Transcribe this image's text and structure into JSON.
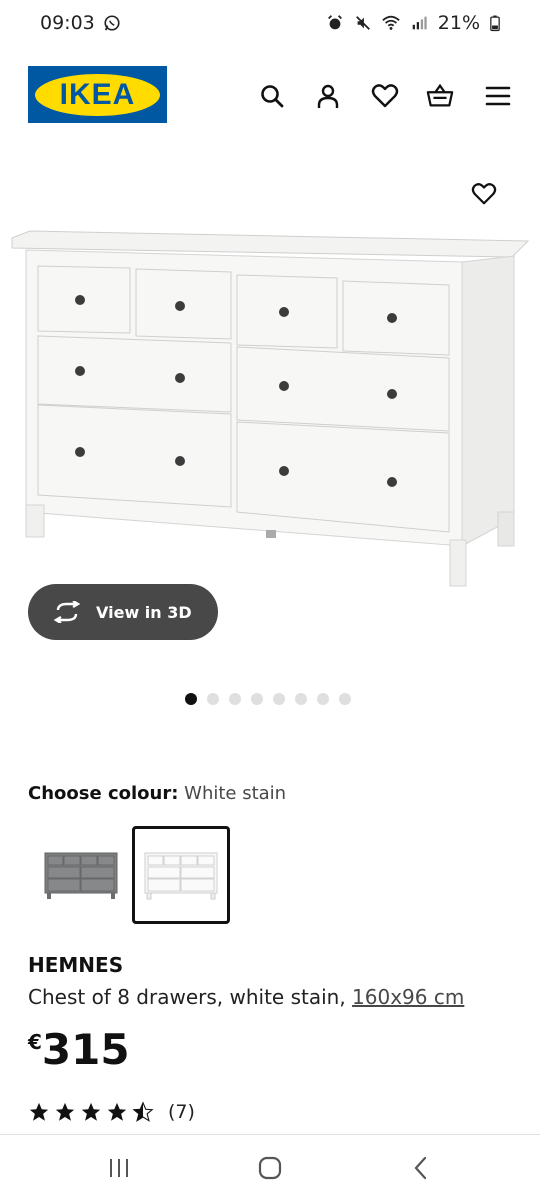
{
  "status": {
    "time": "09:03",
    "battery": "21%"
  },
  "header": {
    "logo_text": "IKEA",
    "icons": [
      "search-icon",
      "account-icon",
      "heart-icon",
      "basket-icon",
      "menu-icon"
    ]
  },
  "hero": {
    "view3d_label": "View in 3D",
    "carousel_count": 8,
    "carousel_active": 0
  },
  "colour": {
    "label": "Choose colour:",
    "value": "White stain",
    "options": [
      "grey",
      "white stain"
    ],
    "selected": 1
  },
  "product": {
    "name": "HEMNES",
    "description": "Chest of 8 drawers, white stain,",
    "dimensions": "160x96 cm",
    "currency": "€",
    "price": "315",
    "rating": 4.5,
    "rating_count": "(7)"
  },
  "colors": {
    "brand_blue": "#0058a3",
    "brand_yellow": "#ffdb00",
    "button_dark": "#484848"
  }
}
